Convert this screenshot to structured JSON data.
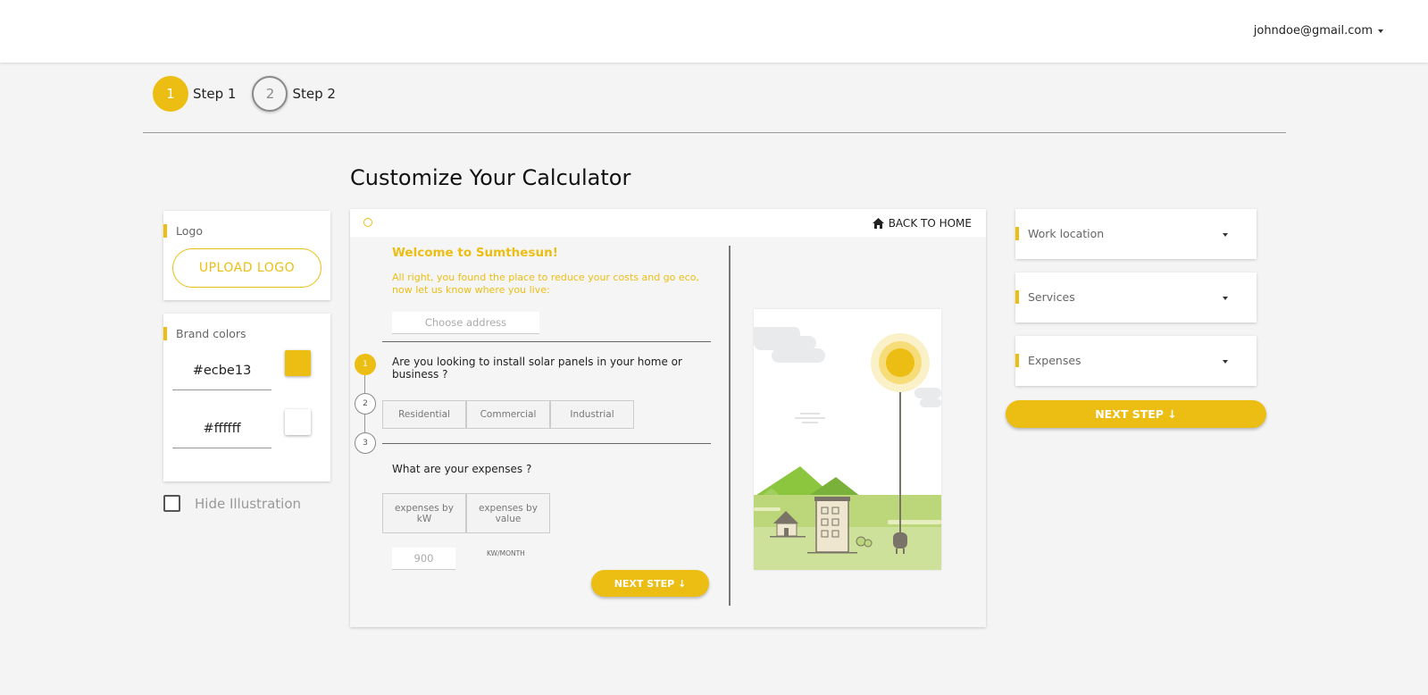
{
  "header": {
    "user_email": "johndoe@gmail.com"
  },
  "stepper": {
    "steps": [
      {
        "number": "1",
        "label": "Step 1"
      },
      {
        "number": "2",
        "label": "Step 2"
      }
    ]
  },
  "page_title": "Customize Your Calculator",
  "left_panel": {
    "logo_card": {
      "label": "Logo",
      "upload_label": "UPLOAD LOGO"
    },
    "brand_colors": {
      "label": "Brand colors",
      "colors": [
        {
          "value": "#ecbe13"
        },
        {
          "value": "#ffffff"
        }
      ]
    },
    "hide_illustration_label": "Hide Illustration"
  },
  "preview": {
    "back_home_label": "BACK TO HOME",
    "welcome_title": "Welcome to Sumthesun!",
    "intro_text": "All right, you found the place to reduce your costs and go eco, now let us know where you live:",
    "address_placeholder": "Choose address",
    "step_numbers": [
      "1",
      "2",
      "3"
    ],
    "question_1": "Are you looking to install solar panels in your home or business ?",
    "options_1": [
      "Residential",
      "Commercial",
      "Industrial"
    ],
    "question_2": "What are your expenses ?",
    "options_2": [
      "expenses by kW",
      "expenses by value"
    ],
    "kw_placeholder": "900",
    "kw_unit": "KW/MONTH",
    "next_label": "NEXT STEP ↓"
  },
  "right_panel": {
    "dropdowns": [
      {
        "label": "Work location"
      },
      {
        "label": "Services"
      },
      {
        "label": "Expenses"
      }
    ],
    "next_label": "NEXT STEP ↓"
  },
  "colors": {
    "accent": "#ecbe13",
    "background": "#f4f4f4"
  }
}
